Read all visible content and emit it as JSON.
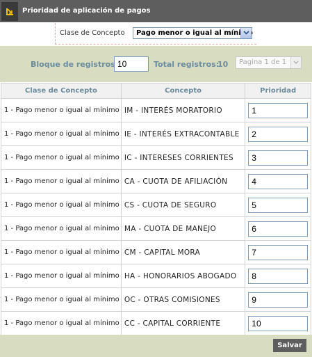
{
  "header": {
    "title": "Prioridad de aplicación de pagos",
    "icon": "corner-arrow-icon",
    "colors": {
      "bar": "#5e5e5e",
      "icon_bg": "#3a3a3a",
      "icon_fg": "#f5c400"
    }
  },
  "filter": {
    "label": "Clase de Concepto",
    "selected": "Pago menor o igual al mínimo"
  },
  "pager": {
    "block_label": "Bloque de registros:",
    "block_value": "10",
    "total_label": "Total registros:",
    "total_value": "10",
    "page_selected": "Pagina 1 de 1"
  },
  "table": {
    "columns": [
      "Clase de Concepto",
      "Concepto",
      "Prioridad"
    ],
    "rows": [
      {
        "clase": "1 - Pago menor o igual al mínimo",
        "concepto": "IM - INTERÉS MORATORIO",
        "prioridad": "1"
      },
      {
        "clase": "1 - Pago menor o igual al mínimo",
        "concepto": "IE - INTERÉS EXTRACONTABLE",
        "prioridad": "2"
      },
      {
        "clase": "1 - Pago menor o igual al mínimo",
        "concepto": "IC - INTERESES CORRIENTES",
        "prioridad": "3"
      },
      {
        "clase": "1 - Pago menor o igual al mínimo",
        "concepto": "CA - CUOTA DE AFILIACIÓN",
        "prioridad": "4"
      },
      {
        "clase": "1 - Pago menor o igual al mínimo",
        "concepto": "CS - CUOTA DE SEGURO",
        "prioridad": "5"
      },
      {
        "clase": "1 - Pago menor o igual al mínimo",
        "concepto": "MA - CUOTA DE MANEJO",
        "prioridad": "6"
      },
      {
        "clase": "1 - Pago menor o igual al mínimo",
        "concepto": "CM - CAPITAL MORA",
        "prioridad": "7"
      },
      {
        "clase": "1 - Pago menor o igual al mínimo",
        "concepto": "HA - HONORARIOS ABOGADO",
        "prioridad": "8"
      },
      {
        "clase": "1 - Pago menor o igual al mínimo",
        "concepto": "OC - OTRAS COMISIONES",
        "prioridad": "9"
      },
      {
        "clase": "1 - Pago menor o igual al mínimo",
        "concepto": "CC - CAPITAL CORRIENTE",
        "prioridad": "10"
      }
    ]
  },
  "footer": {
    "save_label": "Salvar"
  }
}
